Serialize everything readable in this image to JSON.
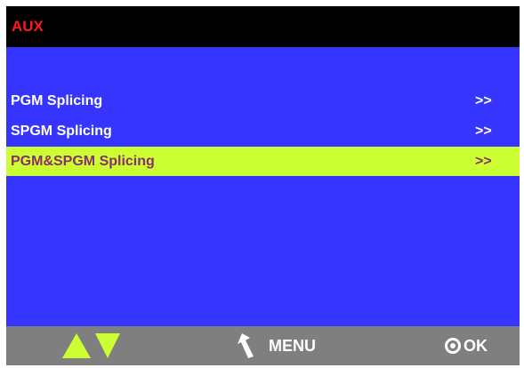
{
  "header": {
    "title": "AUX",
    "title_color": "#ff1a1a"
  },
  "menu": {
    "items": [
      {
        "label": "PGM Splicing",
        "arrow": ">>",
        "selected": false
      },
      {
        "label": "SPGM Splicing",
        "arrow": ">>",
        "selected": false
      },
      {
        "label": "PGM&SPGM Splicing",
        "arrow": ">>",
        "selected": true
      }
    ]
  },
  "footer": {
    "nav_icons": [
      "up-arrow-icon",
      "down-arrow-icon"
    ],
    "back_icon": "return-arrow-icon",
    "menu_label": "MENU",
    "ok_icon": "circle-dot-icon",
    "ok_label": "OK"
  },
  "colors": {
    "background": "#3535ff",
    "title_bar": "#000000",
    "footer": "#7f7f7f",
    "highlight": "#ccff33",
    "highlight_text": "#8a2f6a",
    "nav_arrows": "#ccff33"
  }
}
